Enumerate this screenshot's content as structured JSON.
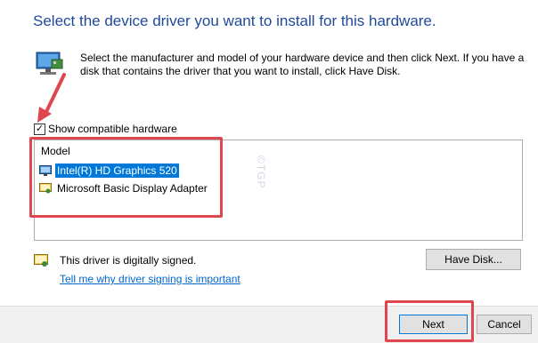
{
  "dialog": {
    "heading": "Select the device driver you want to install for this hardware.",
    "description": "Select the manufacturer and model of your hardware device and then click Next. If you have a disk that contains the driver that you want to install, click Have Disk."
  },
  "compatible": {
    "label": "Show compatible hardware",
    "checked": true,
    "check_glyph": "✓"
  },
  "model_list": {
    "header": "Model",
    "items": [
      {
        "label": "Intel(R) HD Graphics 520",
        "selected": true,
        "icon": "display-adapter-icon"
      },
      {
        "label": "Microsoft Basic Display Adapter",
        "selected": false,
        "icon": "certified-driver-icon"
      }
    ]
  },
  "watermark": "©TGP",
  "signing": {
    "status": "This driver is digitally signed.",
    "link": "Tell me why driver signing is important"
  },
  "buttons": {
    "have_disk": "Have Disk...",
    "next": "Next",
    "cancel": "Cancel"
  },
  "colors": {
    "accent": "#0078d7",
    "heading": "#1f4a9c",
    "annotation_red": "#e0464f",
    "link": "#0066cc"
  }
}
